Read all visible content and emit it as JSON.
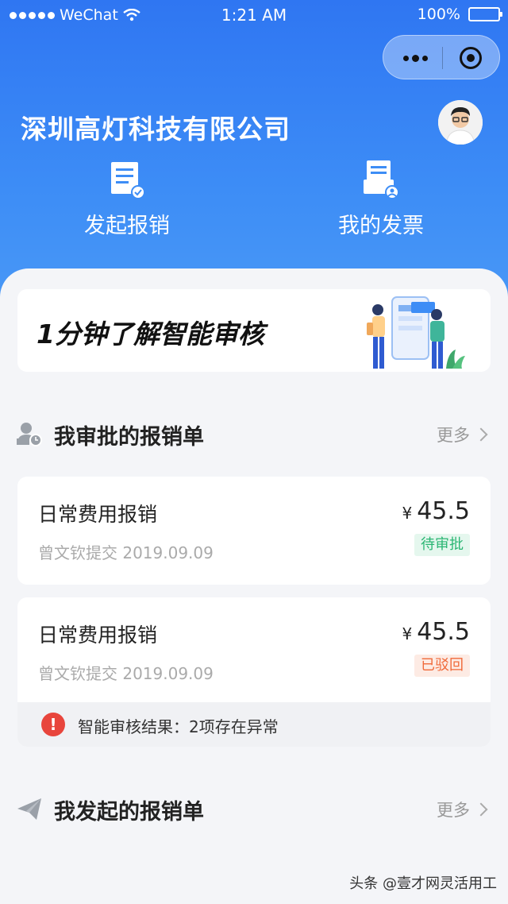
{
  "status_bar": {
    "carrier": "WeChat",
    "time": "1:21 AM",
    "battery": "100%"
  },
  "header": {
    "company_name": "深圳高灯科技有限公司",
    "actions": [
      {
        "label": "发起报销",
        "icon": "document-check-icon"
      },
      {
        "label": "我的发票",
        "icon": "invoice-user-icon"
      }
    ]
  },
  "banner": {
    "title": "1分钟了解智能审核"
  },
  "section_approvals": {
    "title": "我审批的报销单",
    "more": "更多"
  },
  "cards": [
    {
      "title": "日常费用报销",
      "submitter_line": "曾文钦提交  2019.09.09",
      "currency": "¥",
      "amount": "45.5",
      "status": "待审批",
      "status_color": "#2bb673"
    },
    {
      "title": "日常费用报销",
      "submitter_line": "曾文钦提交  2019.09.09",
      "currency": "¥",
      "amount": "45.5",
      "status": "已驳回",
      "status_color": "#f06a3a",
      "alert": "智能审核结果：2项存在异常"
    }
  ],
  "section_submitted": {
    "title": "我发起的报销单",
    "more": "更多"
  },
  "watermark": "头条 @壹才网灵活用工",
  "colors": {
    "header_blue": "#2f76f2",
    "alert_red": "#e8453c"
  }
}
